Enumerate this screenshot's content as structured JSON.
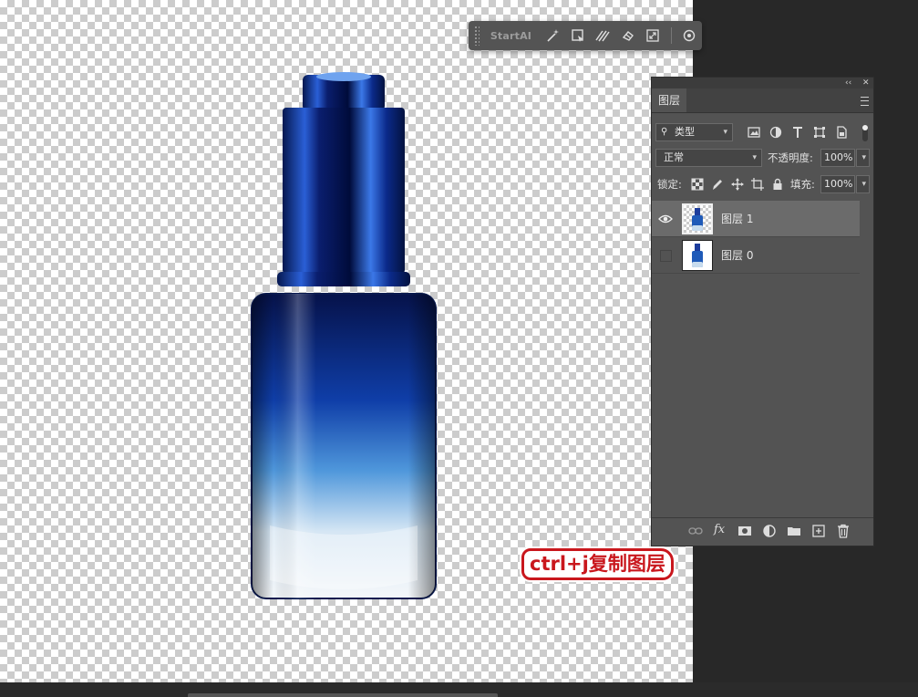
{
  "startai_toolbar": {
    "brand": "StartAI",
    "tools": [
      "magic-wand-icon",
      "select-box-icon",
      "hatch-pattern-icon",
      "eraser-icon",
      "expand-icon",
      "settings-icon"
    ]
  },
  "layers_panel": {
    "tab_label": "图层",
    "filter": {
      "kind_label": "类型"
    },
    "blend_mode": "正常",
    "opacity_label": "不透明度:",
    "opacity_value": "100%",
    "lock_label": "锁定:",
    "fill_label": "填充:",
    "fill_value": "100%",
    "layers": [
      {
        "name": "图层 1",
        "visible": true,
        "selected": true
      },
      {
        "name": "图层 0",
        "visible": false,
        "selected": false
      }
    ]
  },
  "caption": {
    "text": "ctrl+j复制图层"
  },
  "colors": {
    "panel_bg": "#535353",
    "canvas_checker": "#cccccc",
    "caption_red": "#c9171d",
    "bottle_blue": "#0d2a8a"
  }
}
